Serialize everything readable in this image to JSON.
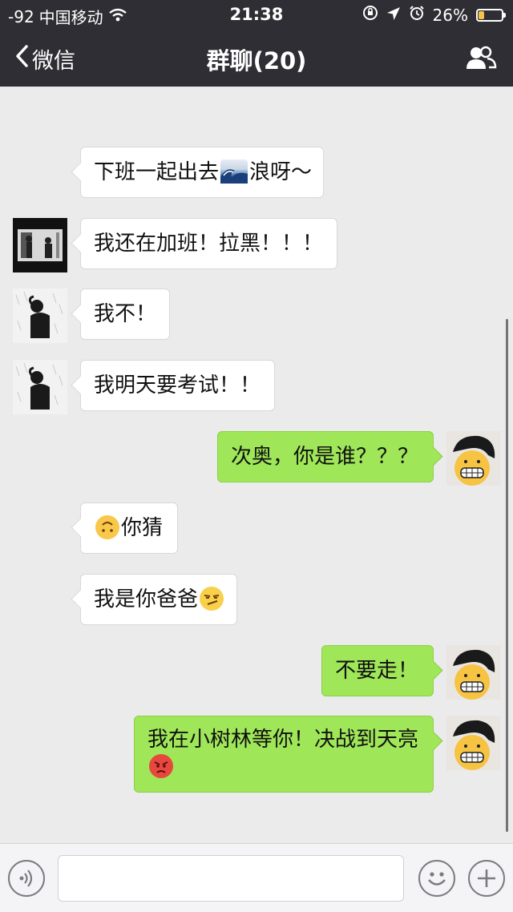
{
  "status_bar": {
    "signal": "-92",
    "carrier": "中国移动",
    "time": "21:38",
    "battery_text": "26%",
    "battery_level": 0.26
  },
  "nav": {
    "back_label": "微信",
    "title": "群聊(20)"
  },
  "messages": [
    {
      "side": "in",
      "has_avatar": false,
      "text_before": "下班一起出去",
      "emoji": "wave-emoji",
      "text_after": "浪呀～"
    },
    {
      "side": "in",
      "has_avatar": true,
      "avatar": "photo-avatar",
      "text_before": "我还在加班！拉黑！！！"
    },
    {
      "side": "in",
      "has_avatar": true,
      "avatar": "person-avatar",
      "text_before": "我不！"
    },
    {
      "side": "in",
      "has_avatar": true,
      "avatar": "person-avatar",
      "text_before": "我明天要考试！！"
    },
    {
      "side": "out",
      "has_avatar": true,
      "avatar": "self-avatar",
      "text_before": "次奥，你是谁？？？"
    },
    {
      "side": "in",
      "has_avatar": false,
      "emoji_before": "upside-down-face-emoji",
      "text_after": "你猜"
    },
    {
      "side": "in",
      "has_avatar": false,
      "text_before": "我是你爸爸",
      "emoji": "smirk-face-emoji"
    },
    {
      "side": "out",
      "has_avatar": true,
      "avatar": "self-avatar",
      "text_before": "不要走！"
    },
    {
      "side": "out",
      "has_avatar": true,
      "avatar": "self-avatar",
      "text_before": "我在小树林等你！决战到天亮",
      "emoji_newline": "angry-face-emoji"
    }
  ],
  "input": {
    "placeholder": "",
    "value": ""
  },
  "colors": {
    "header_bg": "#2f2e34",
    "chat_bg": "#ebebeb",
    "incoming_bubble": "#ffffff",
    "outgoing_bubble": "#9fe658"
  }
}
